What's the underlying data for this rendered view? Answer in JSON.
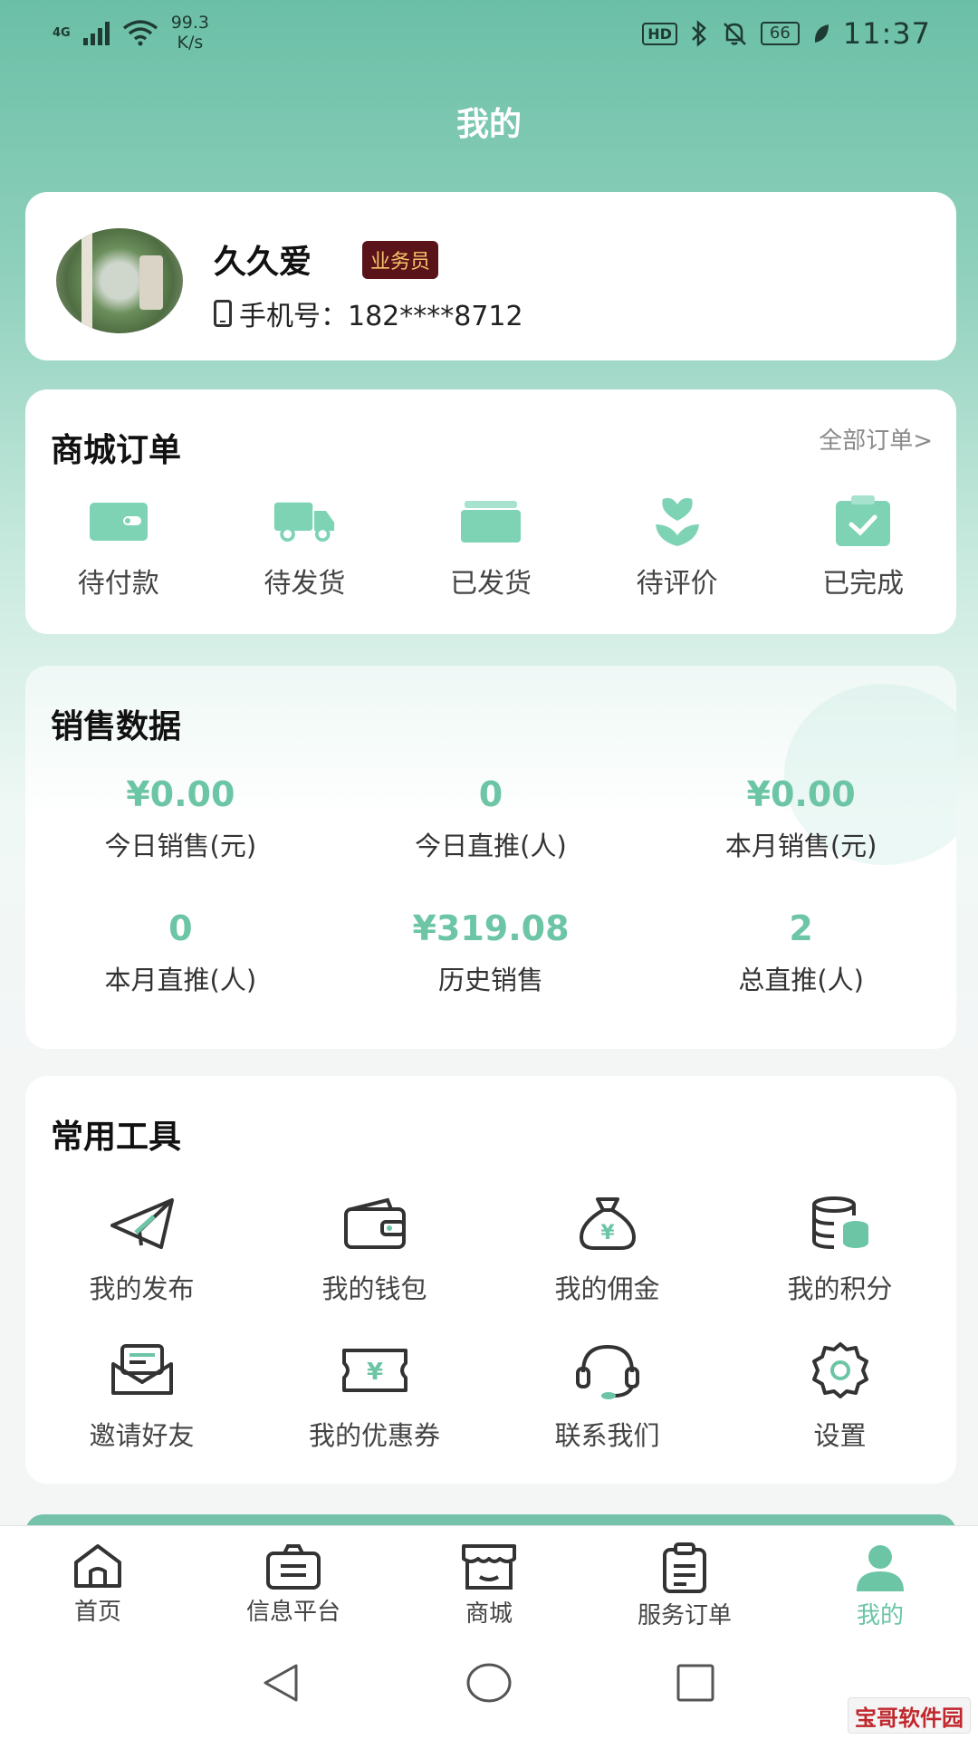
{
  "status_bar": {
    "network": "4G",
    "speed_value": "99.3",
    "speed_unit": "K/s",
    "hd": "HD",
    "battery": "66",
    "time": "11:37"
  },
  "header": {
    "title": "我的"
  },
  "profile": {
    "name": "久久爱",
    "role": "业务员",
    "phone": "手机号：182****8712"
  },
  "orders": {
    "title": "商城订单",
    "all_link": "全部订单>",
    "items": [
      {
        "label": "待付款",
        "icon": "wallet-icon"
      },
      {
        "label": "待发货",
        "icon": "truck-icon"
      },
      {
        "label": "已发货",
        "icon": "box-icon"
      },
      {
        "label": "待评价",
        "icon": "flower-icon"
      },
      {
        "label": "已完成",
        "icon": "clipboard-check-icon"
      }
    ]
  },
  "sales": {
    "title": "销售数据",
    "stats": [
      {
        "value": "¥0.00",
        "caption": "今日销售(元)"
      },
      {
        "value": "0",
        "caption": "今日直推(人)"
      },
      {
        "value": "¥0.00",
        "caption": "本月销售(元)"
      },
      {
        "value": "0",
        "caption": "本月直推(人)"
      },
      {
        "value": "¥319.08",
        "caption": "历史销售"
      },
      {
        "value": "2",
        "caption": "总直推(人)"
      }
    ]
  },
  "tools": {
    "title": "常用工具",
    "items": [
      {
        "label": "我的发布",
        "icon": "paper-plane-icon"
      },
      {
        "label": "我的钱包",
        "icon": "wallet-icon"
      },
      {
        "label": "我的佣金",
        "icon": "money-bag-icon"
      },
      {
        "label": "我的积分",
        "icon": "coins-icon"
      },
      {
        "label": "邀请好友",
        "icon": "envelope-icon"
      },
      {
        "label": "我的优惠券",
        "icon": "coupon-icon"
      },
      {
        "label": "联系我们",
        "icon": "headset-icon"
      },
      {
        "label": "设置",
        "icon": "gear-icon"
      }
    ]
  },
  "tabbar": {
    "items": [
      {
        "label": "首页",
        "icon": "home-icon"
      },
      {
        "label": "信息平台",
        "icon": "briefcase-icon"
      },
      {
        "label": "商城",
        "icon": "store-icon"
      },
      {
        "label": "服务订单",
        "icon": "clipboard-icon"
      },
      {
        "label": "我的",
        "icon": "user-icon",
        "active": true
      }
    ]
  },
  "watermark": "宝哥软件园",
  "colors": {
    "accent": "#6cc5a5",
    "badge_bg": "#5a1419",
    "badge_text": "#f5c36b"
  }
}
